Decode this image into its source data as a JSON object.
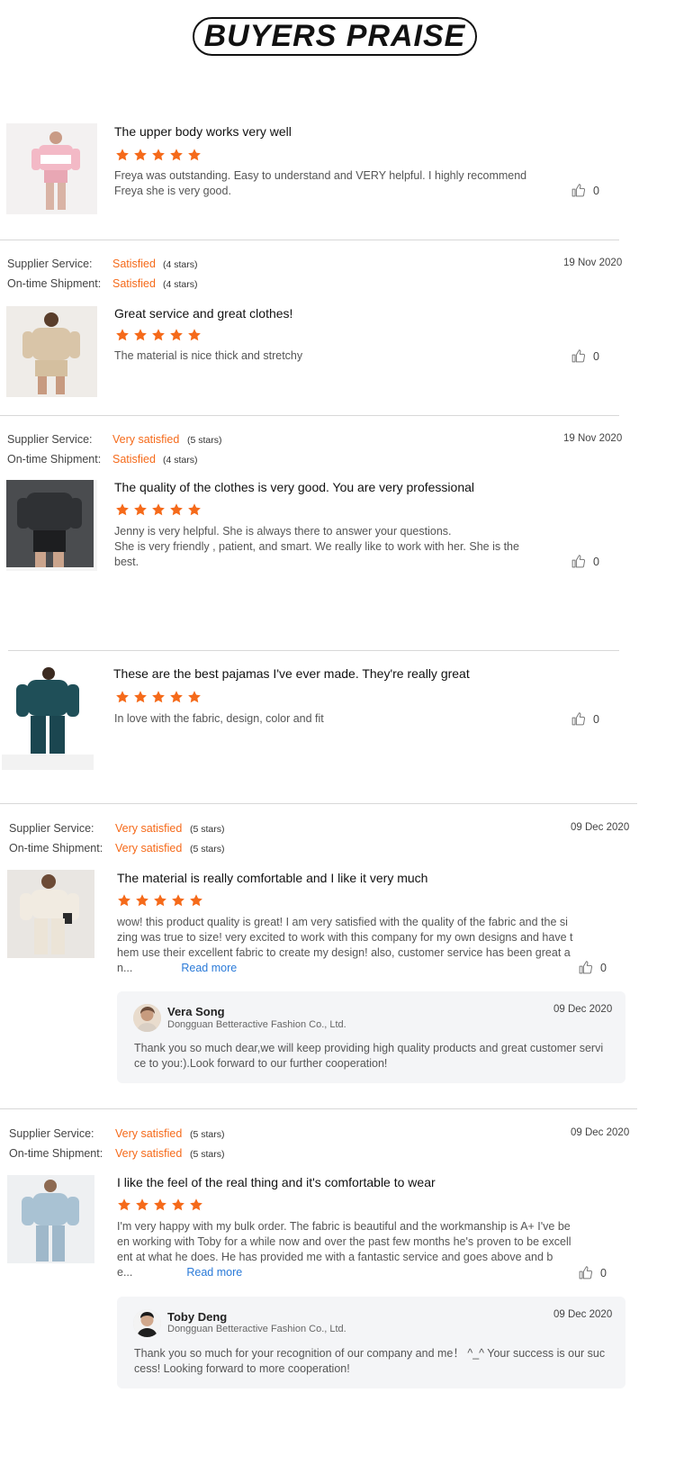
{
  "header": {
    "title": "BUYERS PRAISE"
  },
  "labels": {
    "supplier_service": "Supplier Service:",
    "on_time_shipment": "On-time Shipment:"
  },
  "colors": {
    "accent": "#f56a1a",
    "link": "#2a7ad8",
    "star": "#f56a1a"
  },
  "reviews": [
    {
      "title": "The upper body works very well",
      "rating": 5,
      "text_lines": [
        "Freya was outstanding. Easy to understand and VERY helpful. I highly recommend",
        "Freya she is very good."
      ],
      "likes": "0"
    },
    {
      "supplier_service": "Satisfied",
      "supplier_service_stars": "(4 stars)",
      "on_time_shipment": "Satisfied",
      "on_time_shipment_stars": "(4 stars)",
      "date": "19 Nov 2020",
      "title": "Great service and great clothes!",
      "rating": 5,
      "text_lines": [
        "The material is nice thick and stretchy"
      ],
      "likes": "0"
    },
    {
      "supplier_service": "Very satisfied",
      "supplier_service_stars": "(5 stars)",
      "on_time_shipment": "Satisfied",
      "on_time_shipment_stars": "(4 stars)",
      "date": "19 Nov 2020",
      "title": "The quality of the clothes is very good. You are very professional",
      "rating": 5,
      "text_lines": [
        "Jenny is very helpful. She is always there to answer your questions.",
        "She is  very friendly , patient, and smart. We really like to work with her. She is the",
        "best."
      ],
      "likes": "0"
    },
    {
      "title": "These are the best pajamas I've ever made. They're really great",
      "rating": 5,
      "text_lines": [
        "In love with the fabric, design,  color and fit"
      ],
      "likes": "0"
    },
    {
      "supplier_service": "Very satisfied",
      "supplier_service_stars": "(5 stars)",
      "on_time_shipment": "Very satisfied",
      "on_time_shipment_stars": "(5 stars)",
      "date": "09 Dec 2020",
      "title": "The material is really comfortable and I like it very much",
      "rating": 5,
      "text_lines": [
        "wow! this product quality is great! I am very satisfied with the quality of the fabric and the si",
        "zing was true to size! very excited to work with this company for my own designs and have t",
        "hem use their excellent fabric to create my design! also, customer service has been great a",
        "n..."
      ],
      "read_more": "Read more",
      "likes": "0",
      "reply": {
        "name": "Vera Song",
        "company": "Dongguan Betteractive Fashion Co., Ltd.",
        "date": "09 Dec 2020",
        "text_lines": [
          "Thank you so much dear,we will keep providing high quality products and great customer servi",
          "ce to you:).Look forward to our further cooperation!"
        ]
      }
    },
    {
      "supplier_service": "Very satisfied",
      "supplier_service_stars": "(5 stars)",
      "on_time_shipment": "Very satisfied",
      "on_time_shipment_stars": "(5 stars)",
      "date": "09 Dec 2020",
      "title": "I like the feel of the real thing and it's comfortable to wear",
      "rating": 5,
      "text_lines": [
        "I'm very happy with my bulk order. The fabric is beautiful and the workmanship is A+ I've be",
        "en working with Toby for a while now and over the past few months he's proven to be excell",
        "ent at what he does. He has provided me with a fantastic service and goes above and b",
        "e..."
      ],
      "read_more": "Read more",
      "likes": "0",
      "reply": {
        "name": "Toby Deng",
        "company": "Dongguan Betteractive Fashion Co., Ltd.",
        "date": "09 Dec 2020",
        "text_lines": [
          "Thank you so much for your recognition of our company and me！ ^_^ Your success is our suc",
          "cess! Looking forward to more cooperation!"
        ]
      }
    }
  ]
}
